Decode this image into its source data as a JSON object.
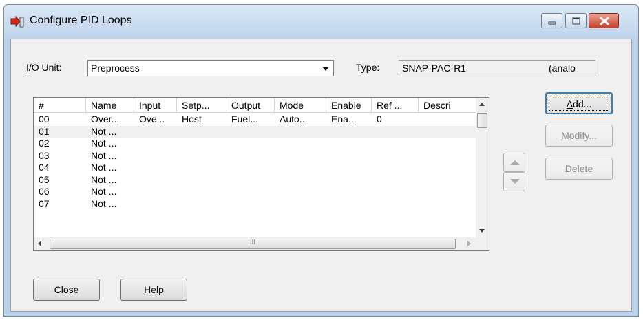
{
  "window": {
    "title": "Configure PID Loops"
  },
  "io_unit": {
    "label_prefix": "I",
    "label_rest": "/O Unit:",
    "value": "Preprocess"
  },
  "type_field": {
    "label": "Type:",
    "value": "SNAP-PAC-R1",
    "value_suffix": "(analo"
  },
  "table": {
    "columns": [
      "#",
      "Name",
      "Input",
      "Setp...",
      "Output",
      "Mode",
      "Enable",
      "Ref ...",
      "Descri"
    ],
    "rows": [
      [
        "00",
        "Over...",
        "Ove...",
        "Host",
        "Fuel...",
        "Auto...",
        "Ena...",
        "0",
        ""
      ],
      [
        "01",
        "Not ...",
        "",
        "",
        "",
        "",
        "",
        "",
        ""
      ],
      [
        "02",
        "Not ...",
        "",
        "",
        "",
        "",
        "",
        "",
        ""
      ],
      [
        "03",
        "Not ...",
        "",
        "",
        "",
        "",
        "",
        "",
        ""
      ],
      [
        "04",
        "Not ...",
        "",
        "",
        "",
        "",
        "",
        "",
        ""
      ],
      [
        "05",
        "Not ...",
        "",
        "",
        "",
        "",
        "",
        "",
        ""
      ],
      [
        "06",
        "Not ...",
        "",
        "",
        "",
        "",
        "",
        "",
        ""
      ],
      [
        "07",
        "Not ...",
        "",
        "",
        "",
        "",
        "",
        "",
        ""
      ]
    ],
    "hscroll_grip": "III"
  },
  "buttons": {
    "add": {
      "first": "A",
      "rest": "dd..."
    },
    "modify": {
      "first": "M",
      "rest": "odify..."
    },
    "delete": {
      "first": "D",
      "rest": "elete"
    },
    "close": "Close",
    "help": {
      "first": "H",
      "rest": "elp"
    }
  }
}
